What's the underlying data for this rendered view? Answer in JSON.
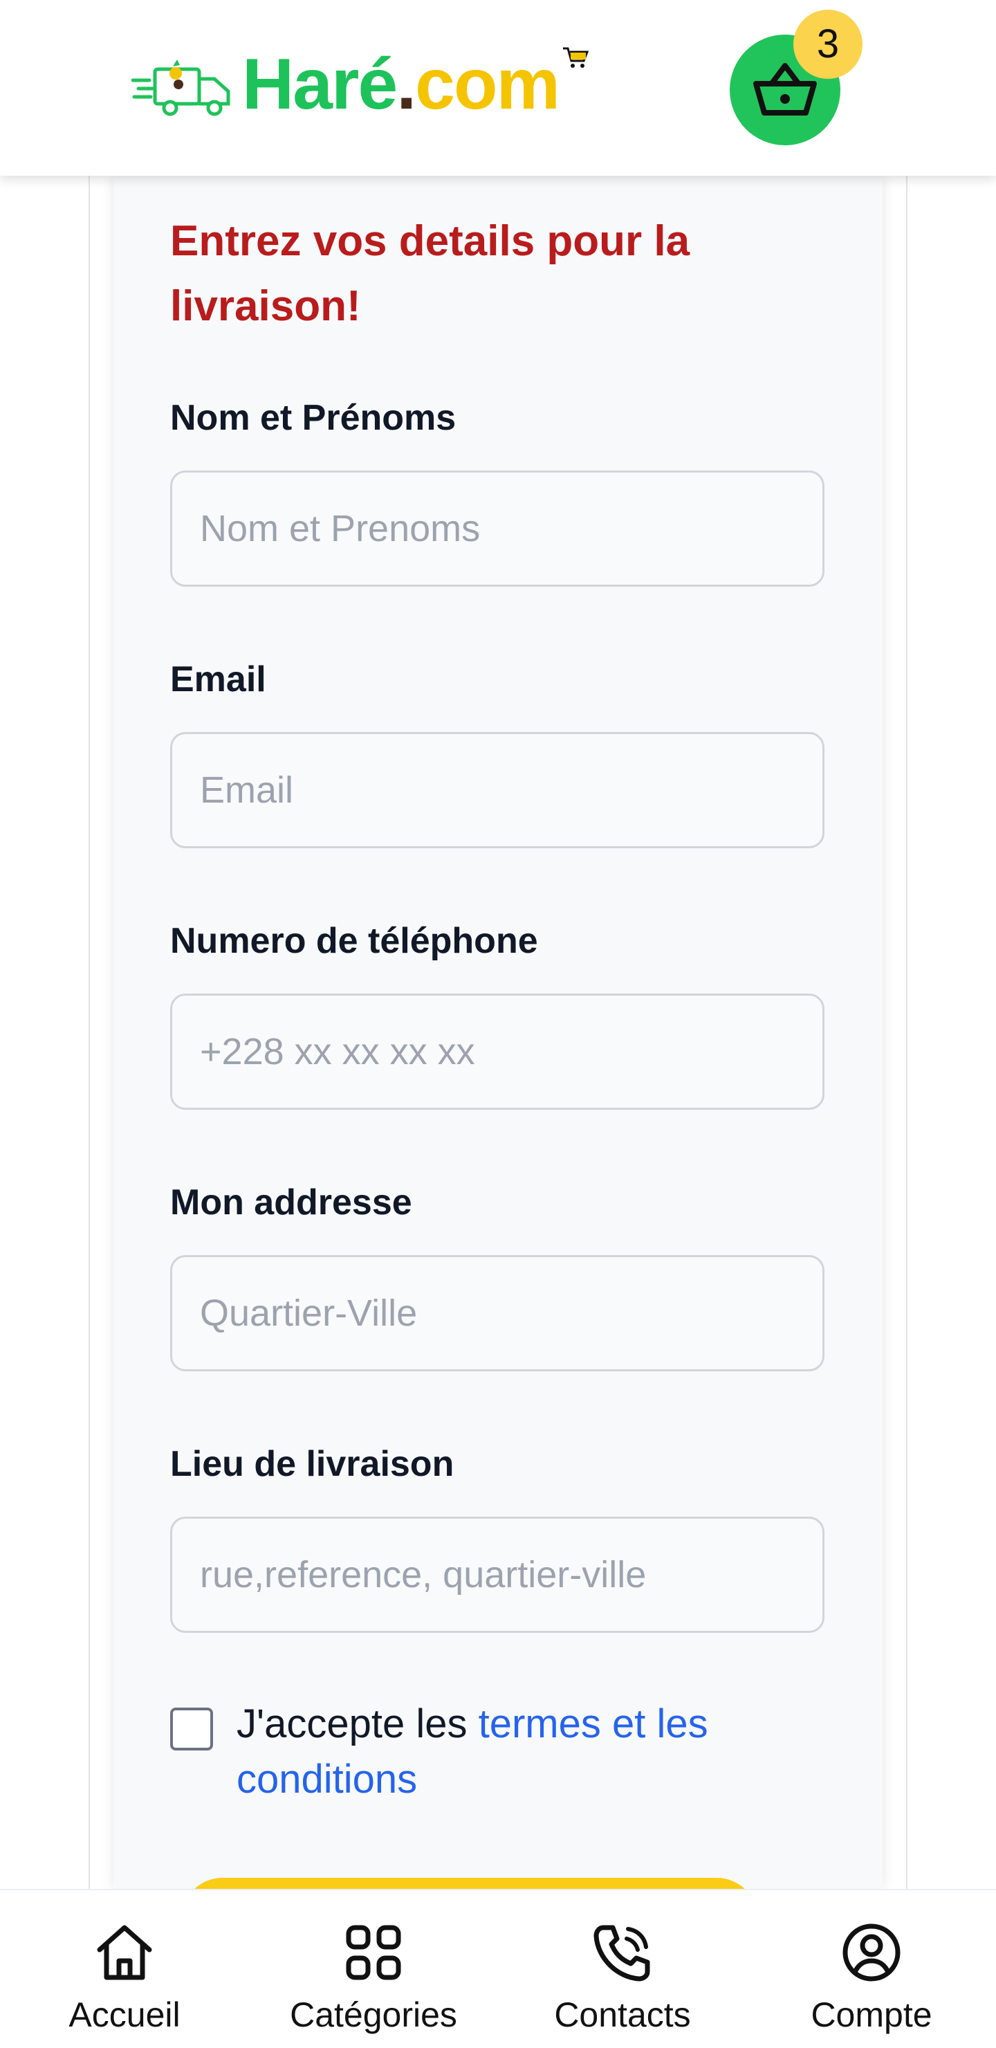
{
  "header": {
    "logo": {
      "name": "Haré",
      "dot": ".",
      "tld": "com"
    },
    "cart_count": "3"
  },
  "form": {
    "title": "Entrez vos details pour la livraison!",
    "fields": [
      {
        "label": "Nom et Prénoms",
        "placeholder": "Nom et Prenoms",
        "value": ""
      },
      {
        "label": "Email",
        "placeholder": "Email",
        "value": ""
      },
      {
        "label": "Numero de téléphone",
        "placeholder": "+228 xx xx xx xx",
        "value": ""
      },
      {
        "label": "Mon addresse",
        "placeholder": "Quartier-Ville",
        "value": ""
      },
      {
        "label": "Lieu de livraison",
        "placeholder": "rue,reference, quartier-ville",
        "value": ""
      }
    ],
    "terms": {
      "prefix": "J'accepte les ",
      "link": "termes et les conditions",
      "checked": false
    }
  },
  "nav": {
    "items": [
      {
        "label": "Accueil",
        "icon": "home-icon"
      },
      {
        "label": "Catégories",
        "icon": "grid-icon"
      },
      {
        "label": "Contacts",
        "icon": "phone-icon"
      },
      {
        "label": "Compte",
        "icon": "user-circle-icon"
      }
    ]
  },
  "colors": {
    "brand_green": "#1ec25a",
    "brand_yellow": "#f5c400",
    "title_red": "#b91c1c",
    "link_blue": "#2563eb",
    "badge_yellow": "#fcd34d"
  }
}
